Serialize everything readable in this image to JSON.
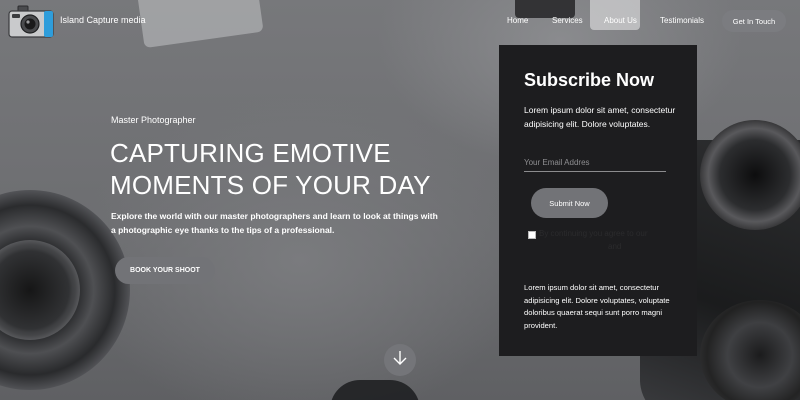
{
  "brand": {
    "name": "Island Capture media",
    "logo_icon": "camera-icon",
    "logo_accent": "#2e9ddb"
  },
  "nav": {
    "items": [
      {
        "label": "Home"
      },
      {
        "label": "Services"
      },
      {
        "label": "About Us"
      },
      {
        "label": "Testimonials"
      }
    ],
    "cta_label": "Get In Touch"
  },
  "hero": {
    "kicker": "Master Photographer",
    "title_line1": "CAPTURING EMOTIVE",
    "title_line2": "MOMENTS OF YOUR DAY",
    "description": "Explore the world with our master photographers and learn to look at things with a photographic eye thanks to the tips of a professional.",
    "button_label": "BOOK YOUR SHOOT",
    "scroll_icon": "arrow-down-icon"
  },
  "subscribe": {
    "title": "Subscribe Now",
    "intro": "Lorem ipsum dolor sit amet, consectetur adipisicing elit. Dolore voluptates.",
    "email_placeholder": "Your Email Addres",
    "submit_label": "Submit Now",
    "agree_line1": "By continuing you agree to our",
    "agree_line2": "and",
    "footer_text": "Lorem ipsum dolor sit amet, consectetur adipisicing elit. Dolore voluptates, voluptate doloribus quaerat sequi sunt porro magni provident."
  },
  "colors": {
    "panel_bg": "#1d1d1f",
    "button_bg": "#727377",
    "text": "#ffffff"
  }
}
